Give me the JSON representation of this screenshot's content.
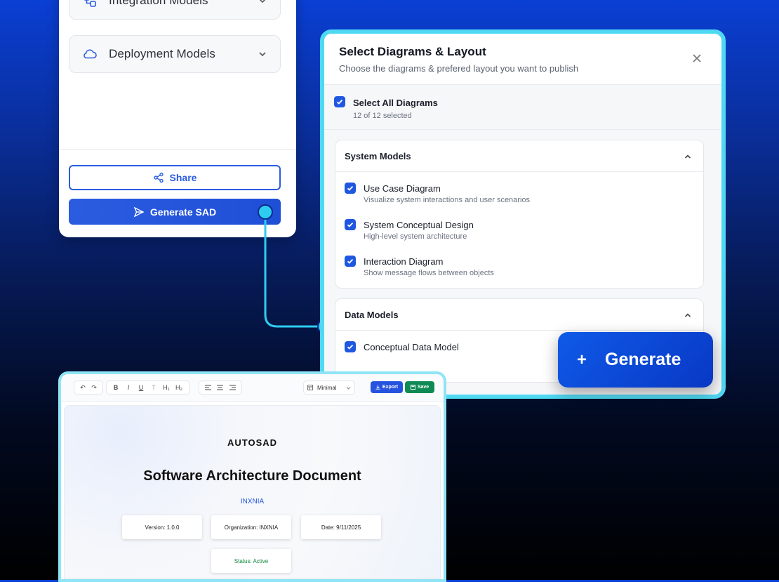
{
  "sidebar": {
    "accordions": [
      {
        "label": "Integration Models",
        "icon": "integration-icon"
      },
      {
        "label": "Deployment Models",
        "icon": "cloud-icon"
      }
    ],
    "share_label": "Share",
    "generate_sad_label": "Generate SAD"
  },
  "modal": {
    "title": "Select Diagrams & Layout",
    "subtitle": "Choose the diagrams & prefered layout you want to publish",
    "select_all_label": "Select All Diagrams",
    "select_all_count": "12 of 12 selected",
    "groups": [
      {
        "title": "System Models",
        "items": [
          {
            "label": "Use Case Diagram",
            "desc": "Visualize system interactions and user scenarios",
            "checked": true
          },
          {
            "label": "System Conceptual Design",
            "desc": "High-level system architecture",
            "checked": true
          },
          {
            "label": "Interaction Diagram",
            "desc": "Show message flows between objects",
            "checked": true
          }
        ]
      },
      {
        "title": "Data Models",
        "items": [
          {
            "label": "Conceptual Data Model",
            "checked": true
          }
        ]
      }
    ],
    "generate_label": "Generate",
    "generate_icon": "+"
  },
  "editor": {
    "toolbar": {
      "undo_icon": "↶",
      "redo_icon": "↷",
      "bold": "B",
      "italic": "I",
      "underline": "U",
      "text": "T",
      "h1": "H₁",
      "h2": "H₂",
      "layout_select": "Minimal",
      "export_label": "Export",
      "save_label": "Save"
    },
    "document": {
      "logo": "AUTOSAD",
      "title": "Software Architecture Document",
      "organization_name": "INXNIA",
      "version": "Version: 1.0.0",
      "organization": "Organization: INXNIA",
      "date": "Date: 9/11/2025",
      "status": "Status: Active"
    }
  },
  "colors": {
    "primary": "#1f57e0",
    "accent_cyan": "#4fd8f2",
    "status_green": "#0f8a3c",
    "save_green": "#0f8a55"
  }
}
